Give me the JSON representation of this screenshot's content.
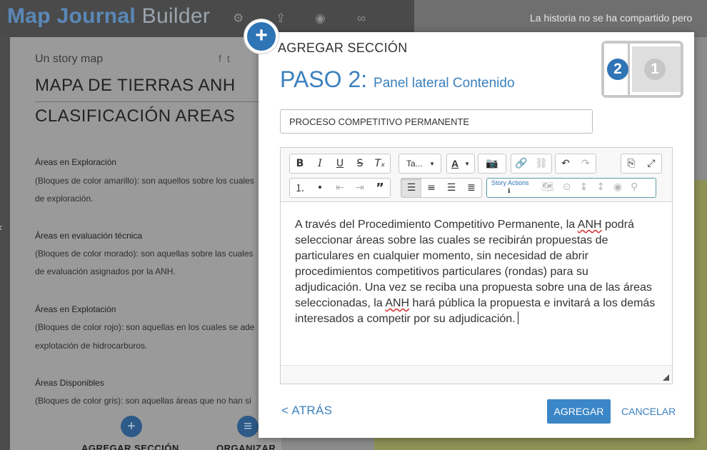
{
  "app": {
    "title_bold": "Map Journal",
    "title_light": "Builder",
    "share_note": "La historia no se ha compartido pero",
    "top_icons": [
      "settings-icon",
      "share-icon",
      "preview-icon",
      "binoculars-icon"
    ]
  },
  "story_panel": {
    "byline": "Un story map",
    "title_line1": "MAPA DE TIERRAS ANH",
    "title_line2": "CLASIFICACIÓN AREAS",
    "sections": [
      {
        "heading": "Áreas en Exploración",
        "line1": "(Bloques de color amarillo): son aquellos sobre los cuales",
        "line2": "de exploración."
      },
      {
        "heading": "Áreas en evaluación técnica",
        "line1": "(Bloques de color morado): son aquellas sobre las cuales",
        "line2": "de evaluación asignados por la ANH."
      },
      {
        "heading": "Áreas en Explotación",
        "line1": "(Bloques de color rojo): son aquellas en los cuales se ade",
        "line2": "explotación de hidrocarburos."
      },
      {
        "heading": "Áreas Disponibles",
        "line1": "(Bloques de color gris): son aquellas áreas que no han si"
      }
    ],
    "add_section_label": "AGREGAR SECCIÓN",
    "organize_label": "ORGANIZAR"
  },
  "dialog": {
    "title": "AGREGAR SECCIÓN",
    "step": "PASO 2:",
    "step_subtitle": "Panel lateral Contenido",
    "layout_side_number": "2",
    "layout_main_number": "1",
    "section_title_value": "PROCESO COMPETITIVO PERMANENTE",
    "toolbar": {
      "font_dropdown": "Ta...",
      "color_dropdown": "A",
      "story_actions_label": "Story Actions",
      "story_actions_info": "ℹ"
    },
    "content": {
      "p1": "A través del Procedimiento Competitivo Permanente, la ",
      "anh1": "ANH",
      "p2": " podrá seleccionar áreas sobre las cuales se recibirán propuestas de particulares en cualquier momento, sin necesidad de abrir procedimientos competitivos particulares (rondas) para su adjudicación. Una vez se reciba una propuesta sobre una de las áreas seleccionadas, la ",
      "anh2": "ANH",
      "p3": " hará pública la propuesta e invitará a los demás interesados a competir por su adjudicación."
    },
    "back_label": "< ATRÁS",
    "add_label": "AGREGAR",
    "cancel_label": "CANCELAR"
  },
  "colors": {
    "accent": "#3b80bd",
    "primary_button": "#3b86c6",
    "badge": "#2f74b5"
  }
}
